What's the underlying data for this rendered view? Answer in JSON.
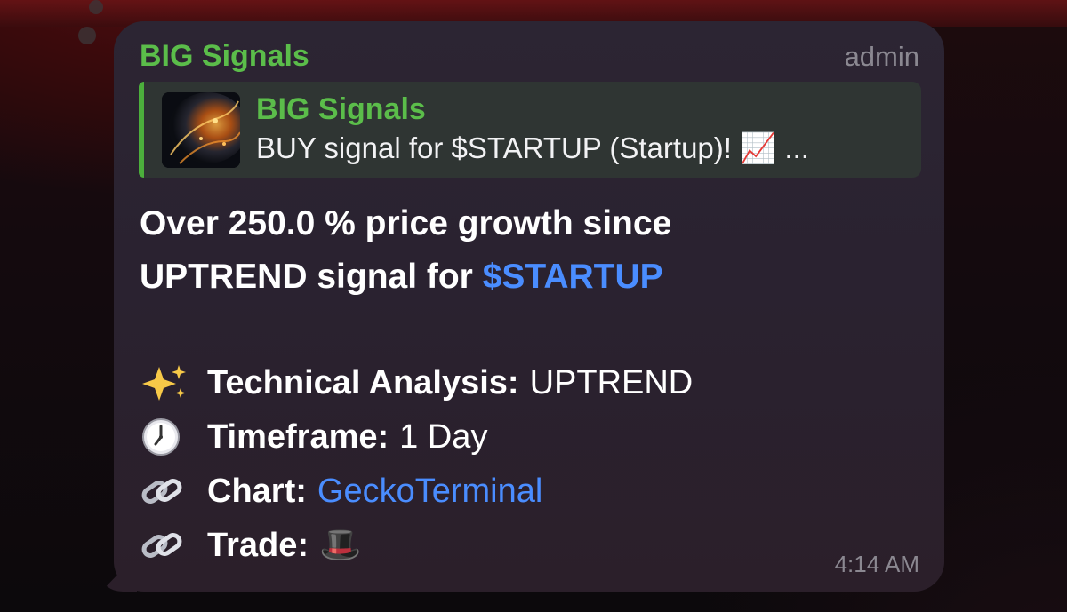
{
  "message": {
    "sender": "BIG Signals",
    "author_badge": "admin",
    "reply": {
      "title": "BIG Signals",
      "text": "BUY signal for $STARTUP (Startup)! 📈 ..."
    },
    "headline_part1": "Over 250.0 % price growth since",
    "headline_part2": "UPTREND signal for",
    "headline_ticker": "$STARTUP",
    "details": [
      {
        "icon": "sparkles-icon",
        "key": "Technical Analysis:",
        "value": "UPTREND"
      },
      {
        "icon": "clock-icon",
        "key": "Timeframe:",
        "value": "1 Day"
      },
      {
        "icon": "link-icon",
        "key": "Chart:",
        "value": "GeckoTerminal"
      },
      {
        "icon": "link-icon",
        "key": "Trade:",
        "value": "🎩"
      }
    ],
    "time": "4:14 AM"
  },
  "colors": {
    "sender_green": "#5bbd4a",
    "link_blue": "#4a8dff",
    "bubble_bg": "#2c2533"
  }
}
